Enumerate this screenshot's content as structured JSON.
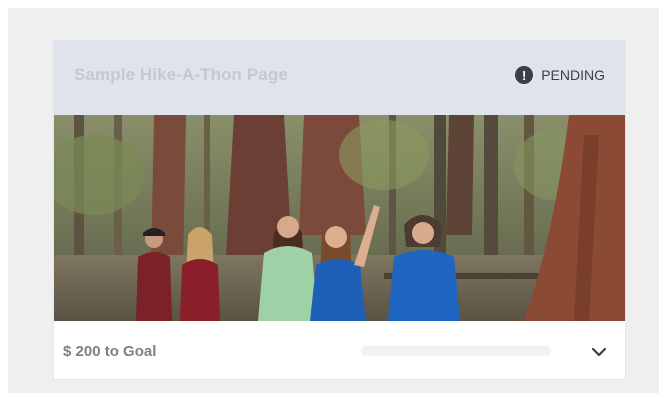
{
  "card": {
    "title": "Sample Hike-A-Thon Page",
    "status_label": "PENDING",
    "status_icon": "exclamation-circle-icon",
    "hero_image": "hikers-in-forest-photo",
    "goal_text": "$ 200 to Goal",
    "progress_fraction": 0,
    "expand_icon": "chevron-down-icon"
  },
  "colors": {
    "page_bg": "#efefef",
    "header_bg": "#dfe4ec",
    "title": "#c2c9d3",
    "status_icon_bg": "#3b3f45",
    "goal_text": "#7b8088",
    "progress_track": "#f1f2f4"
  }
}
